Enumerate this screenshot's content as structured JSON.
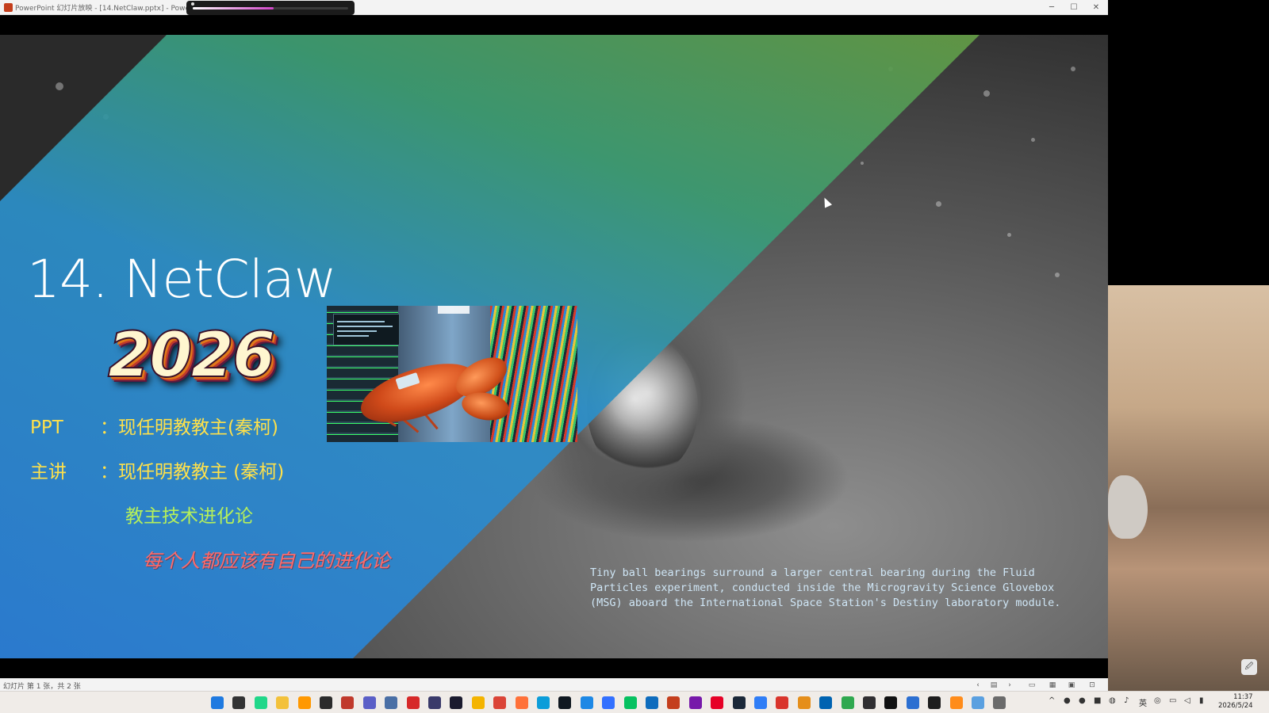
{
  "window": {
    "title": "PowerPoint 幻灯片放映 - [14.NetClaw.pptx] - PowerPoint",
    "recording_progress": 0.52,
    "minimize_glyph": "─",
    "maximize_glyph": "☐",
    "close_glyph": "✕"
  },
  "slide": {
    "title": "14. NetClaw",
    "year": "2026",
    "ppt_label": "PPT",
    "ppt_value": "：现任明教教主(秦柯)",
    "speaker_label": "主讲",
    "speaker_value": "：现任明教教主 (秦柯)",
    "series": "教主技术进化论",
    "motto": "每个人都应该有自己的进化论",
    "image_screen_text": "Automate your network, fully. An AI agent that claws through your network.",
    "image_tag_text": "AI001",
    "caption": "Tiny ball bearings surround a larger central bearing during the Fluid Particles experiment, conducted inside the Microgravity Science Glovebox (MSG) aboard the International Space Station's Destiny laboratory module."
  },
  "statusbar": {
    "text": "幻灯片 第 1 张，共 2 张",
    "prev_glyph": "‹",
    "menu_glyph": "▤",
    "next_glyph": "›",
    "view_normal": "▭",
    "view_sorter": "▦",
    "view_reading": "▣",
    "view_show": "⊡"
  },
  "tray": {
    "ime": "英",
    "time": "11:37",
    "date": "2026/5/24",
    "desktop_button": "🖉"
  },
  "colors": {
    "title": "#ffffff",
    "info": "#ffe14a",
    "series": "#b6f05a",
    "motto": "#ff6a6a",
    "caption": "#cfe6f6"
  },
  "taskbar_icons": [
    {
      "name": "windows-start-icon",
      "color": "#1f7ae0"
    },
    {
      "name": "task-view-icon",
      "color": "#333333"
    },
    {
      "name": "pycharm-icon",
      "color": "#21d789"
    },
    {
      "name": "file-explorer-icon",
      "color": "#f3c13a"
    },
    {
      "name": "sublime-text-icon",
      "color": "#ff9800"
    },
    {
      "name": "terminal-icon",
      "color": "#2b2b2b"
    },
    {
      "name": "snipping-tool-icon",
      "color": "#c0392b"
    },
    {
      "name": "teams-icon",
      "color": "#5b5fc7"
    },
    {
      "name": "save-disk-icon",
      "color": "#4a6fa5"
    },
    {
      "name": "recorder-icon",
      "color": "#d62828"
    },
    {
      "name": "owl-app-icon",
      "color": "#3a3a6a"
    },
    {
      "name": "remote-desktop-icon",
      "color": "#1a1a2e"
    },
    {
      "name": "chrome-canary-icon",
      "color": "#f4b400"
    },
    {
      "name": "chrome-icon",
      "color": "#db4437"
    },
    {
      "name": "firefox-icon",
      "color": "#ff7139"
    },
    {
      "name": "edge-icon",
      "color": "#0c9dd9"
    },
    {
      "name": "cursor-app-icon",
      "color": "#101820"
    },
    {
      "name": "cloud-app-icon",
      "color": "#1e88e5"
    },
    {
      "name": "feishu-icon",
      "color": "#3370ff"
    },
    {
      "name": "wechat-icon",
      "color": "#07c160"
    },
    {
      "name": "outlook-icon",
      "color": "#0f6cbd"
    },
    {
      "name": "powerpoint-icon",
      "color": "#c43e1c"
    },
    {
      "name": "onenote-icon",
      "color": "#7719aa"
    },
    {
      "name": "netease-music-icon",
      "color": "#e60026"
    },
    {
      "name": "steam-icon",
      "color": "#1b2838"
    },
    {
      "name": "tencent-docs-icon",
      "color": "#2f7df6"
    },
    {
      "name": "wps-icon",
      "color": "#d9342b"
    },
    {
      "name": "virtual-machine-icon",
      "color": "#e58e1a"
    },
    {
      "name": "rdp-icon",
      "color": "#0063b1"
    },
    {
      "name": "browser-alt-icon",
      "color": "#2fa84f"
    },
    {
      "name": "obs-icon",
      "color": "#302e31"
    },
    {
      "name": "notepad-icon",
      "color": "#111111"
    },
    {
      "name": "remote-app-icon",
      "color": "#2c6fd1"
    },
    {
      "name": "cmd-icon",
      "color": "#1e1e1e"
    },
    {
      "name": "notification-app-icon",
      "color": "#ff8c1a"
    },
    {
      "name": "photos-icon",
      "color": "#5aa0e0"
    },
    {
      "name": "settings-icon",
      "color": "#6b6b6b"
    }
  ],
  "tray_icons": [
    {
      "name": "tray-chevron-icon",
      "glyph": "^"
    },
    {
      "name": "tray-wechat-icon",
      "glyph": "●"
    },
    {
      "name": "tray-record-icon",
      "glyph": "●"
    },
    {
      "name": "tray-app-icon",
      "glyph": "■"
    },
    {
      "name": "tray-network-icon",
      "glyph": "◍"
    },
    {
      "name": "tray-mic-icon",
      "glyph": "♪"
    },
    {
      "name": "tray-ime-icon",
      "glyph": "英"
    },
    {
      "name": "tray-update-icon",
      "glyph": "◎"
    },
    {
      "name": "tray-display-icon",
      "glyph": "▭"
    },
    {
      "name": "tray-volume-icon",
      "glyph": "◁"
    },
    {
      "name": "tray-battery-icon",
      "glyph": "▮"
    }
  ]
}
